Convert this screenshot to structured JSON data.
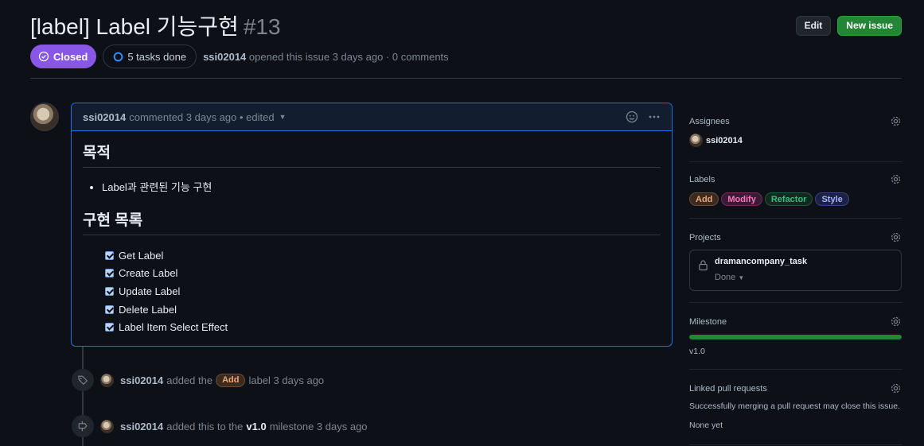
{
  "issue": {
    "title": "[label] Label 기능구현",
    "number": "#13",
    "state": "Closed",
    "tasks": "5 tasks done",
    "author": "ssi02014",
    "opened_text": "opened this issue 3 days ago · 0 comments"
  },
  "header": {
    "edit_label": "Edit",
    "new_issue_label": "New issue"
  },
  "comment": {
    "author": "ssi02014",
    "meta": "commented 3 days ago • edited",
    "heading1": "목적",
    "bullets": [
      "Label과 관련된 기능 구현"
    ],
    "heading2": "구현 목록",
    "tasks": [
      "Get Label",
      "Create Label",
      "Update Label",
      "Delete Label",
      "Label Item Select Effect"
    ]
  },
  "timeline": [
    {
      "icon": "tag-icon",
      "actor": "ssi02014",
      "pre": "added the",
      "label": "Add",
      "post": "label 3 days ago"
    },
    {
      "icon": "milestone-icon",
      "actor": "ssi02014",
      "pre": "added this to the",
      "milestone": "v1.0",
      "post": "milestone 3 days ago"
    }
  ],
  "sidebar": {
    "assignees": {
      "title": "Assignees",
      "user": "ssi02014"
    },
    "labels": {
      "title": "Labels",
      "items": [
        {
          "name": "Add",
          "color": "#e8a87c",
          "bg": "#3d2a1f"
        },
        {
          "name": "Modify",
          "color": "#f778ba",
          "bg": "#3b1a35"
        },
        {
          "name": "Refactor",
          "color": "#3fb984",
          "bg": "#12291f"
        },
        {
          "name": "Style",
          "color": "#a5b4fc",
          "bg": "#1c2044"
        }
      ]
    },
    "projects": {
      "title": "Projects",
      "name": "dramancompany_task",
      "status": "Done"
    },
    "milestone": {
      "title": "Milestone",
      "name": "v1.0",
      "progress": 1.0
    },
    "linked_prs": {
      "title": "Linked pull requests",
      "desc": "Successfully merging a pull request may close this issue.",
      "none": "None yet"
    }
  },
  "colors": {
    "accent": "#1f6feb",
    "closed": "#8957e5",
    "green": "#238636"
  }
}
